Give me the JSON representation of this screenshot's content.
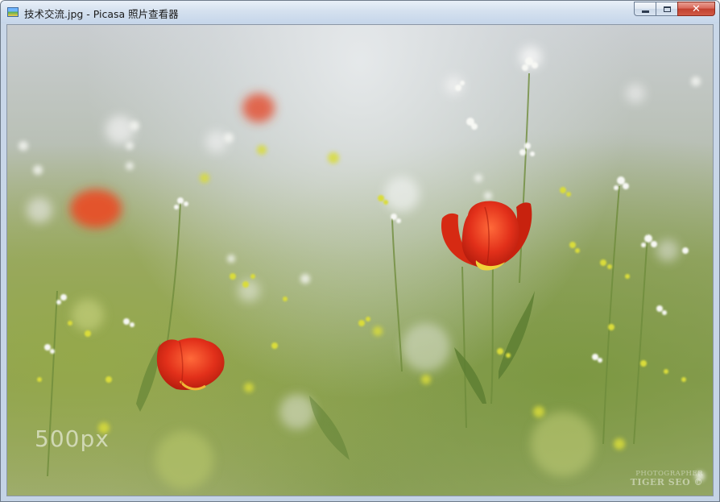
{
  "window": {
    "title": "技术交流.jpg - Picasa 照片查看器",
    "app_icon": "picasa-photo-icon"
  },
  "caption_buttons": {
    "minimize_icon": "minimize-icon",
    "maximize_icon": "maximize-icon",
    "close_icon": "close-icon",
    "close_glyph": "✕"
  },
  "photo": {
    "subject": "red tulips in a field of white and yellow wildflowers",
    "watermark_site": "500px",
    "watermark_credit_line1": "PHOTOGRAPHER",
    "watermark_credit_line2": "TIGER SEO ©"
  },
  "colors": {
    "tulip_red": "#e02a14",
    "close_button": "#c2412f",
    "titlebar": "#d5e1ef"
  }
}
